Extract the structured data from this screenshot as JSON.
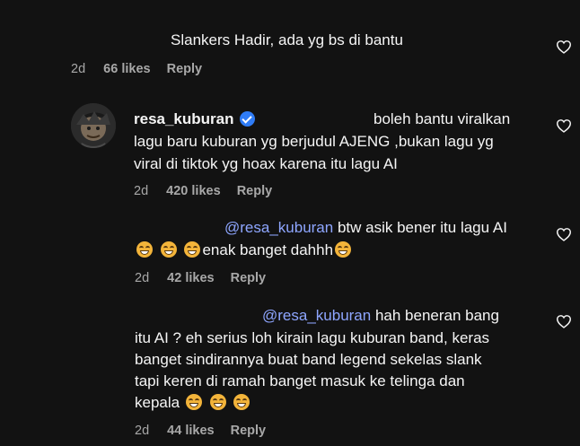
{
  "comments": [
    {
      "text": "Slankers Hadir, ada yg bs di bantu",
      "time": "2d",
      "likes": "66 likes",
      "reply": "Reply"
    },
    {
      "username": "resa_kuburan",
      "verified": true,
      "lines": [
        "boleh bantu viralkan",
        "lagu baru kuburan yg berjudul AJENG ,bukan lagu yg",
        "viral di tiktok yg hoax karena itu lagu AI"
      ],
      "time": "2d",
      "likes": "420 likes",
      "reply": "Reply"
    },
    {
      "mention": "@resa_kuburan",
      "line1_rest": " btw asik bener itu lagu AI",
      "line2_text": "enak banget dahhh",
      "time": "2d",
      "likes": "42 likes",
      "reply": "Reply"
    },
    {
      "mention": "@resa_kuburan",
      "line1_rest": " hah beneran bang",
      "lines": [
        "itu AI ? eh serius loh kirain lagu kuburan band, keras",
        "banget sindirannya buat band legend sekelas slank",
        "tapi keren di ramah banget masuk ke telinga dan"
      ],
      "last_line_text": "kepala",
      "time": "2d",
      "likes": "44 likes",
      "reply": "Reply"
    }
  ],
  "icons": {
    "like": "heart-outline-icon",
    "emoji": "grinning-squinting-face-emoji",
    "verified": "verified-badge-icon"
  },
  "colors": {
    "background": "#121212",
    "mention": "#8ea6ff",
    "meta": "#a8a8a8",
    "verified": "#2f7cf6"
  }
}
